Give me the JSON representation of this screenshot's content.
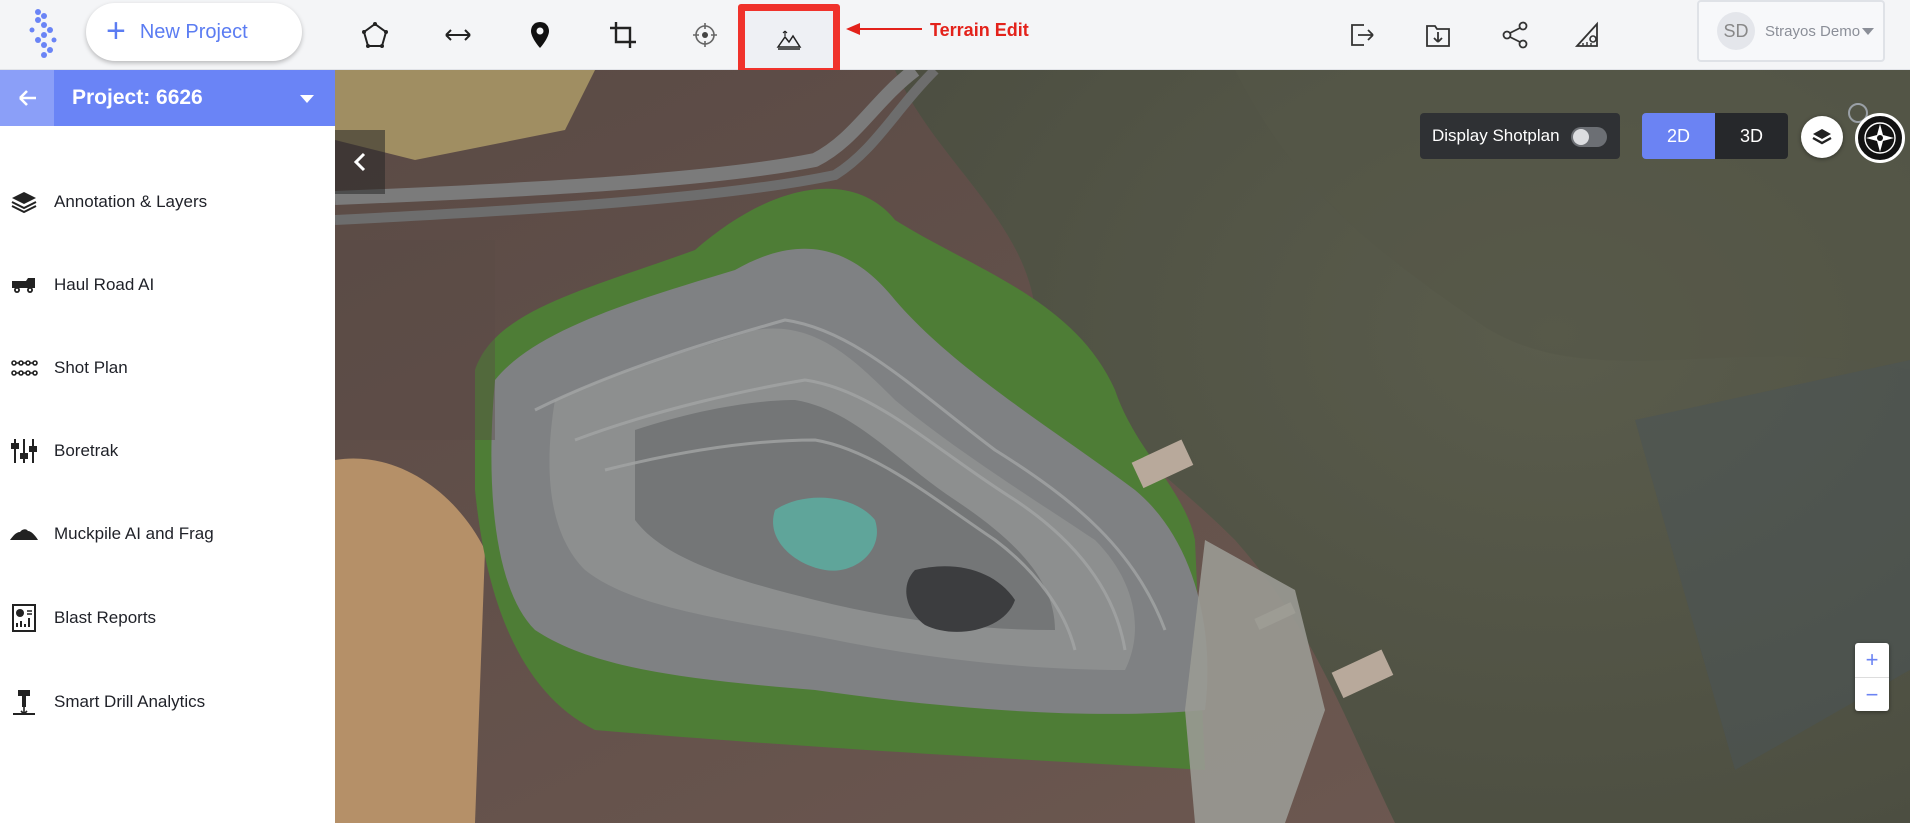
{
  "header": {
    "new_project_label": "New Project",
    "annotation_label": "Terrain Edit",
    "user": {
      "initials": "SD",
      "name": "Strayos Demo"
    },
    "tools": [
      {
        "name": "polygon-tool",
        "icon": "polygon-icon"
      },
      {
        "name": "measure-tool",
        "icon": "double-arrow-icon"
      },
      {
        "name": "marker-tool",
        "icon": "map-pin-icon"
      },
      {
        "name": "crop-tool",
        "icon": "crop-icon"
      },
      {
        "name": "target-tool",
        "icon": "crosshair-icon"
      },
      {
        "name": "terrain-edit-tool",
        "icon": "terrain-edit-icon",
        "highlighted": true
      },
      {
        "name": "export-tool",
        "icon": "export-icon"
      },
      {
        "name": "download-tool",
        "icon": "download-icon"
      },
      {
        "name": "share-tool",
        "icon": "share-icon"
      },
      {
        "name": "settings-tool",
        "icon": "ruler-gear-icon"
      }
    ]
  },
  "sidebar": {
    "project_title": "Project: 6626",
    "items": [
      {
        "label": "Annotation & Layers",
        "icon": "layers-icon"
      },
      {
        "label": "Haul Road AI",
        "icon": "haul-truck-icon"
      },
      {
        "label": "Shot Plan",
        "icon": "shot-plan-icon"
      },
      {
        "label": "Boretrak",
        "icon": "sliders-icon"
      },
      {
        "label": "Muckpile AI and Frag",
        "icon": "muckpile-icon"
      },
      {
        "label": "Blast Reports",
        "icon": "report-icon"
      },
      {
        "label": "Smart Drill Analytics",
        "icon": "drill-icon"
      }
    ]
  },
  "map": {
    "display_shotplan_label": "Display Shotplan",
    "shotplan_enabled": false,
    "view_modes": [
      "2D",
      "3D"
    ],
    "active_view": "2D",
    "zoom_in": "+",
    "zoom_out": "−"
  },
  "colors": {
    "accent": "#6a84f6",
    "highlight": "#f0322b",
    "annotation_text": "#e3221b"
  }
}
